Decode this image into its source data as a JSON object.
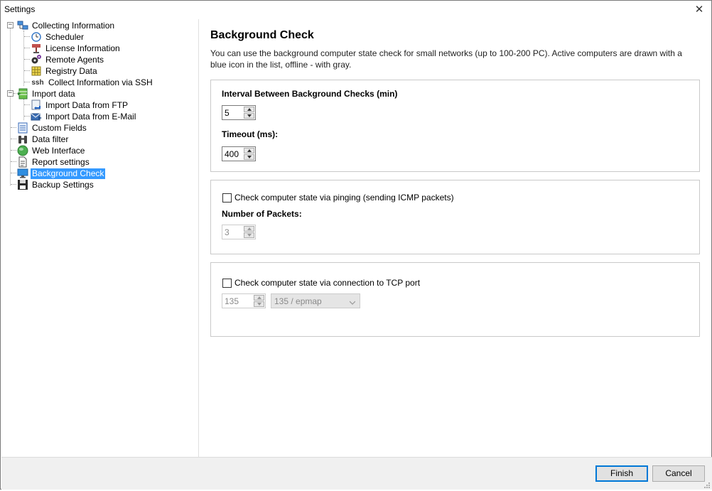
{
  "window": {
    "title": "Settings"
  },
  "tree": {
    "items": [
      {
        "label": "Collecting Information",
        "icon": "network-computers-icon",
        "expander": "−"
      },
      {
        "label": "Scheduler",
        "icon": "clock-icon"
      },
      {
        "label": "License Information",
        "icon": "stamp-icon"
      },
      {
        "label": "Remote Agents",
        "icon": "gears-icon"
      },
      {
        "label": "Registry Data",
        "icon": "grid-icon"
      },
      {
        "label": "Collect Information via SSH",
        "icon": "ssh-icon",
        "icon_text": "ssh"
      },
      {
        "label": "Import data",
        "icon": "import-table-icon",
        "expander": "−"
      },
      {
        "label": "Import Data from FTP",
        "icon": "ftp-import-icon"
      },
      {
        "label": "Import Data from E-Mail",
        "icon": "email-import-icon"
      },
      {
        "label": "Custom Fields",
        "icon": "list-icon"
      },
      {
        "label": "Data filter",
        "icon": "binoculars-icon"
      },
      {
        "label": "Web Interface",
        "icon": "globe-icon"
      },
      {
        "label": "Report settings",
        "icon": "report-icon"
      },
      {
        "label": "Background Check",
        "icon": "monitor-icon",
        "selected": true
      },
      {
        "label": "Backup Settings",
        "icon": "floppy-disk-icon"
      }
    ]
  },
  "content": {
    "title": "Background Check",
    "description": "You can use the background computer state check for small networks (up to 100-200 PC). Active computers are drawn with a blue icon in the list, offline - with gray.",
    "interval": {
      "label": "Interval Between Background Checks (min)",
      "value": "5"
    },
    "timeout": {
      "label": "Timeout (ms):",
      "value": "400"
    },
    "ping": {
      "checkbox_label": "Check computer state via pinging (sending ICMP packets)",
      "checked": false
    },
    "packets": {
      "label": "Number of Packets:",
      "value": "3"
    },
    "tcp": {
      "checkbox_label": "Check computer state via connection to TCP port",
      "checked": false,
      "port": "135",
      "service": "135 / epmap"
    }
  },
  "footer": {
    "finish_label": "Finish",
    "cancel_label": "Cancel"
  },
  "colors": {
    "selection": "#3399ff",
    "button_focus": "#0078d7",
    "footer_bg": "#f0f0f0"
  }
}
